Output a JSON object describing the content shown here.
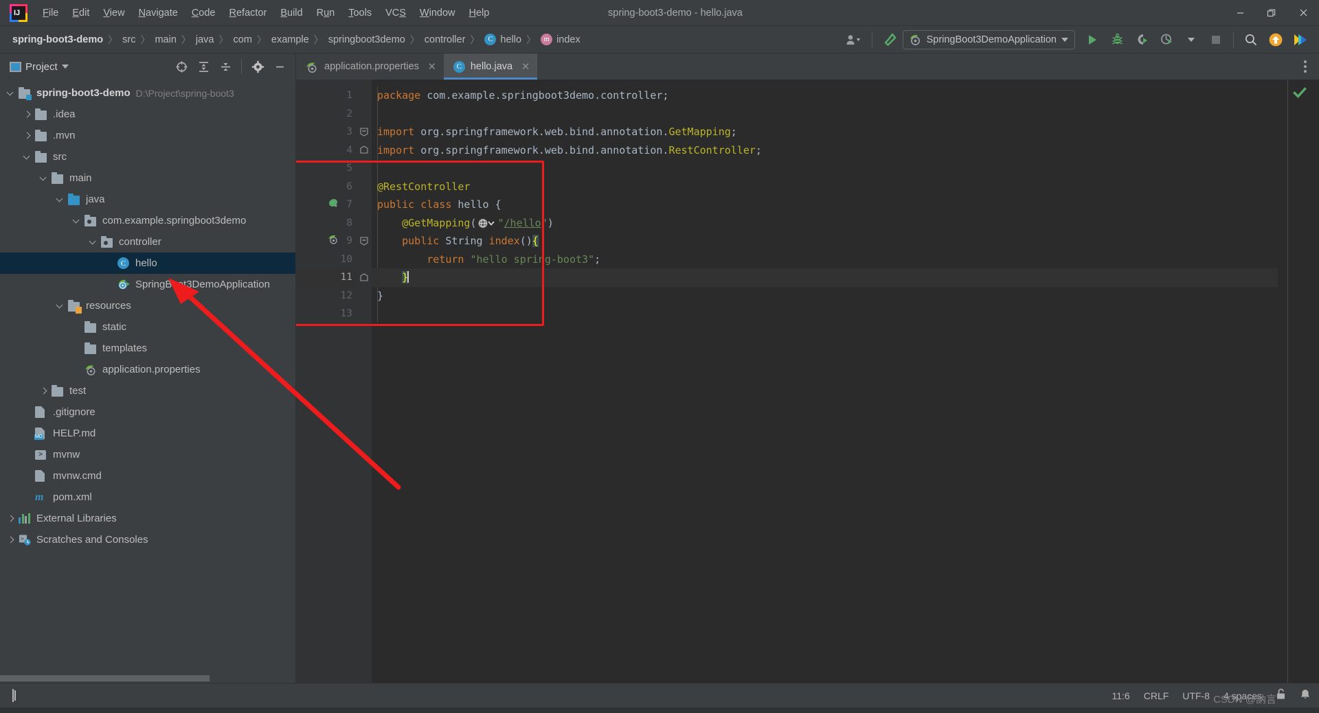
{
  "window": {
    "title": "spring-boot3-demo - hello.java",
    "controls": {
      "minimize": "—",
      "restore": "❐",
      "close": "✕"
    }
  },
  "menubar": {
    "items": [
      {
        "label": "File",
        "mnemonic": "F"
      },
      {
        "label": "Edit",
        "mnemonic": "E"
      },
      {
        "label": "View",
        "mnemonic": "V"
      },
      {
        "label": "Navigate",
        "mnemonic": "N"
      },
      {
        "label": "Code",
        "mnemonic": "C"
      },
      {
        "label": "Refactor",
        "mnemonic": "R"
      },
      {
        "label": "Build",
        "mnemonic": "B"
      },
      {
        "label": "Run",
        "mnemonic": "u"
      },
      {
        "label": "Tools",
        "mnemonic": "T"
      },
      {
        "label": "VCS",
        "mnemonic": "S"
      },
      {
        "label": "Window",
        "mnemonic": "W"
      },
      {
        "label": "Help",
        "mnemonic": "H"
      }
    ]
  },
  "breadcrumb": {
    "items": [
      {
        "label": "spring-boot3-demo",
        "icon": "none",
        "root": true
      },
      {
        "label": "src",
        "icon": "none"
      },
      {
        "label": "main",
        "icon": "none"
      },
      {
        "label": "java",
        "icon": "none"
      },
      {
        "label": "com",
        "icon": "none"
      },
      {
        "label": "example",
        "icon": "none"
      },
      {
        "label": "springboot3demo",
        "icon": "none"
      },
      {
        "label": "controller",
        "icon": "none"
      },
      {
        "label": "hello",
        "icon": "class-badge-icon",
        "badge": "C"
      },
      {
        "label": "index",
        "icon": "method-badge-icon",
        "badge": "m"
      }
    ]
  },
  "toolbar": {
    "run_config": {
      "label": "SpringBoot3DemoApplication",
      "icon": "spring-boot-icon",
      "dropdown": "chevron-down-icon"
    },
    "buttons": [
      {
        "name": "user-settings-icon",
        "label": ""
      },
      {
        "name": "build-hammer-icon",
        "label": ""
      },
      {
        "name": "run-button",
        "label": ""
      },
      {
        "name": "debug-button",
        "label": ""
      },
      {
        "name": "run-coverage-button",
        "label": ""
      },
      {
        "name": "profiler-button",
        "label": ""
      },
      {
        "name": "stop-button",
        "label": ""
      },
      {
        "name": "search-everywhere-button",
        "label": ""
      },
      {
        "name": "update-project-button",
        "label": ""
      },
      {
        "name": "ide-assistant-button",
        "label": ""
      }
    ]
  },
  "project_panel": {
    "title": "Project",
    "actions": [
      {
        "name": "select-opened-file-icon"
      },
      {
        "name": "expand-all-icon"
      },
      {
        "name": "collapse-all-icon"
      },
      {
        "name": "settings-gear-icon"
      },
      {
        "name": "hide-panel-icon"
      }
    ],
    "tree": [
      {
        "label": "spring-boot3-demo",
        "path": "D:\\Project\\spring-boot3",
        "depth": 0,
        "icon": "module-folder-icon",
        "state": "open",
        "bold": true
      },
      {
        "label": ".idea",
        "depth": 1,
        "icon": "folder-icon",
        "state": "closed"
      },
      {
        "label": ".mvn",
        "depth": 1,
        "icon": "folder-icon",
        "state": "closed"
      },
      {
        "label": "src",
        "depth": 1,
        "icon": "folder-icon",
        "state": "open"
      },
      {
        "label": "main",
        "depth": 2,
        "icon": "folder-icon",
        "state": "open"
      },
      {
        "label": "java",
        "depth": 3,
        "icon": "source-folder-icon",
        "state": "open"
      },
      {
        "label": "com.example.springboot3demo",
        "depth": 4,
        "icon": "package-icon",
        "state": "open"
      },
      {
        "label": "controller",
        "depth": 5,
        "icon": "package-icon",
        "state": "open"
      },
      {
        "label": "hello",
        "depth": 6,
        "icon": "java-class-icon",
        "state": "leaf",
        "selected": true
      },
      {
        "label": "SpringBoot3DemoApplication",
        "depth": 6,
        "icon": "spring-run-icon",
        "state": "leaf"
      },
      {
        "label": "resources",
        "depth": 3,
        "icon": "resources-folder-icon",
        "state": "open"
      },
      {
        "label": "static",
        "depth": 4,
        "icon": "folder-icon",
        "state": "leaf"
      },
      {
        "label": "templates",
        "depth": 4,
        "icon": "folder-icon",
        "state": "leaf"
      },
      {
        "label": "application.properties",
        "depth": 4,
        "icon": "spring-properties-icon",
        "state": "leaf"
      },
      {
        "label": "test",
        "depth": 2,
        "icon": "folder-icon",
        "state": "closed"
      },
      {
        "label": ".gitignore",
        "depth": 1,
        "icon": "gitignore-icon",
        "state": "leaf"
      },
      {
        "label": "HELP.md",
        "depth": 1,
        "icon": "markdown-icon",
        "state": "leaf"
      },
      {
        "label": "mvnw",
        "depth": 1,
        "icon": "shell-script-icon",
        "state": "leaf"
      },
      {
        "label": "mvnw.cmd",
        "depth": 1,
        "icon": "cmd-file-icon",
        "state": "leaf"
      },
      {
        "label": "pom.xml",
        "depth": 1,
        "icon": "maven-icon",
        "state": "leaf"
      },
      {
        "label": "External Libraries",
        "depth": 0,
        "icon": "libraries-icon",
        "state": "closed"
      },
      {
        "label": "Scratches and Consoles",
        "depth": 0,
        "icon": "scratches-icon",
        "state": "closed"
      }
    ]
  },
  "editor": {
    "tabs": [
      {
        "label": "application.properties",
        "icon": "spring-properties-icon",
        "active": false,
        "close": "✕"
      },
      {
        "label": "hello.java",
        "icon": "java-class-icon",
        "active": true,
        "close": "✕"
      }
    ],
    "line_numbers": [
      "1",
      "2",
      "3",
      "4",
      "5",
      "6",
      "7",
      "8",
      "9",
      "10",
      "11",
      "12",
      "13"
    ],
    "current_line": 11,
    "code_lines": [
      {
        "n": 1,
        "tokens": [
          {
            "t": "package ",
            "c": "kw"
          },
          {
            "t": "com.example.springboot3demo.controller;",
            "c": "pln"
          }
        ]
      },
      {
        "n": 2,
        "tokens": []
      },
      {
        "n": 3,
        "tokens": [
          {
            "t": "import ",
            "c": "kw"
          },
          {
            "t": "org.springframework.web.bind.annotation.",
            "c": "pln"
          },
          {
            "t": "GetMapping",
            "c": "ann"
          },
          {
            "t": ";",
            "c": "pln"
          }
        ]
      },
      {
        "n": 4,
        "tokens": [
          {
            "t": "import ",
            "c": "kw"
          },
          {
            "t": "org.springframework.web.bind.annotation.",
            "c": "pln"
          },
          {
            "t": "RestController",
            "c": "ann"
          },
          {
            "t": ";",
            "c": "pln"
          }
        ]
      },
      {
        "n": 5,
        "tokens": []
      },
      {
        "n": 6,
        "tokens": [
          {
            "t": "@RestController",
            "c": "ann"
          }
        ]
      },
      {
        "n": 7,
        "tokens": [
          {
            "t": "public class ",
            "c": "kw"
          },
          {
            "t": "hello ",
            "c": "pln"
          },
          {
            "t": "{",
            "c": "pln"
          }
        ]
      },
      {
        "n": 8,
        "tokens": [
          {
            "t": "    ",
            "c": "pln"
          },
          {
            "t": "@GetMapping",
            "c": "ann"
          },
          {
            "t": "(",
            "c": "pln"
          },
          {
            "t": "\"",
            "c": "str"
          },
          {
            "t": "/hello",
            "c": "lnk"
          },
          {
            "t": "\"",
            "c": "str"
          },
          {
            "t": ")",
            "c": "pln"
          }
        ]
      },
      {
        "n": 9,
        "tokens": [
          {
            "t": "    ",
            "c": "pln"
          },
          {
            "t": "public ",
            "c": "kw"
          },
          {
            "t": "String ",
            "c": "cls"
          },
          {
            "t": "index",
            "c": "kw"
          },
          {
            "t": "()",
            "c": "pln"
          },
          {
            "t": "{",
            "c": "brace"
          }
        ]
      },
      {
        "n": 10,
        "tokens": [
          {
            "t": "        ",
            "c": "pln"
          },
          {
            "t": "return ",
            "c": "kw"
          },
          {
            "t": "\"hello spring-boot3\"",
            "c": "str"
          },
          {
            "t": ";",
            "c": "pln"
          }
        ]
      },
      {
        "n": 11,
        "tokens": [
          {
            "t": "    ",
            "c": "pln"
          },
          {
            "t": "}",
            "c": "brace"
          }
        ]
      },
      {
        "n": 12,
        "tokens": [
          {
            "t": "}",
            "c": "pln"
          }
        ]
      },
      {
        "n": 13,
        "tokens": []
      }
    ],
    "gutter_icons": [
      {
        "line": 7,
        "name": "spring-bean-icon"
      },
      {
        "line": 9,
        "name": "spring-endpoint-icon"
      }
    ],
    "inspection_status": "ok-check-icon",
    "annotation": {
      "type": "red-rectangle-highlight",
      "color": "#ee1c1c"
    }
  },
  "statusbar": {
    "layout_icon": "layout-toggle-icon",
    "caret_position": "11:6",
    "line_separator": "CRLF",
    "encoding": "UTF-8",
    "indent": "4 spaces",
    "lock_icon": "unlocked-icon",
    "notification_icon": "bell-icon",
    "watermark": "CSDN @訥言"
  },
  "colors": {
    "accent_blue": "#3592c4",
    "selection_blue": "#0d293e",
    "editor_bg": "#2b2b2b",
    "panel_bg": "#3c3f41",
    "annotation_red": "#ee1c1c",
    "run_green": "#59a869",
    "keyword_orange": "#cc7832",
    "string_green": "#6a8759",
    "annotation_yellow": "#bbb529"
  }
}
